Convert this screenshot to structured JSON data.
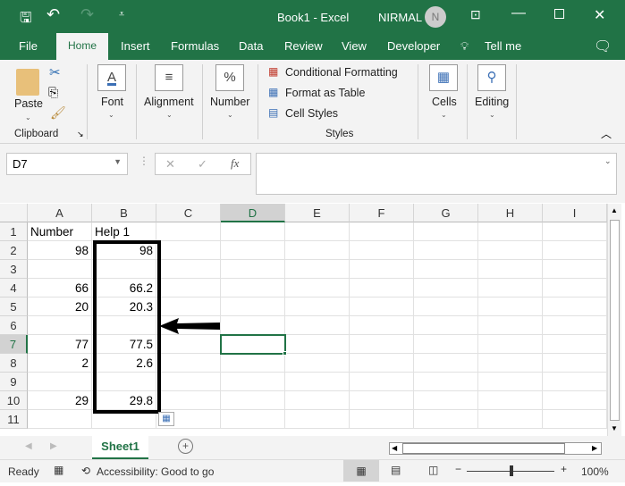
{
  "title": {
    "doc": "Book1  -  Excel",
    "user": "NIRMAL",
    "avatar": "N"
  },
  "tabs": [
    "File",
    "Home",
    "Insert",
    "Formulas",
    "Data",
    "Review",
    "View",
    "Developer",
    "Tell me"
  ],
  "ribbon": {
    "paste": "Paste",
    "clipboard": "Clipboard",
    "font": "Font",
    "alignment": "Alignment",
    "number": "Number",
    "cond": "Conditional Formatting",
    "table": "Format as Table",
    "cellstyles": "Cell Styles",
    "styles": "Styles",
    "cells": "Cells",
    "editing": "Editing"
  },
  "formula": {
    "namebox": "D7",
    "fx": "fx",
    "cancel": "✕",
    "enter": "✓",
    "content": ""
  },
  "columns": [
    "A",
    "B",
    "C",
    "D",
    "E",
    "F",
    "G",
    "H",
    "I"
  ],
  "rows": [
    "1",
    "2",
    "3",
    "4",
    "5",
    "6",
    "7",
    "8",
    "9",
    "10",
    "11"
  ],
  "cells": [
    [
      "Number",
      "Help 1"
    ],
    [
      "98",
      "98"
    ],
    [
      "",
      ""
    ],
    [
      "66",
      "66.2"
    ],
    [
      "20",
      "20.3"
    ],
    [
      "",
      ""
    ],
    [
      "77",
      "77.5"
    ],
    [
      "2",
      "2.6"
    ],
    [
      "",
      ""
    ],
    [
      "29",
      "29.8"
    ],
    [
      "",
      ""
    ]
  ],
  "selected_cell": "D7",
  "sheet": {
    "name": "Sheet1"
  },
  "status": {
    "ready": "Ready",
    "accessibility": "Accessibility: Good to go",
    "zoom": "100%"
  },
  "colors": {
    "accent": "#217346"
  }
}
